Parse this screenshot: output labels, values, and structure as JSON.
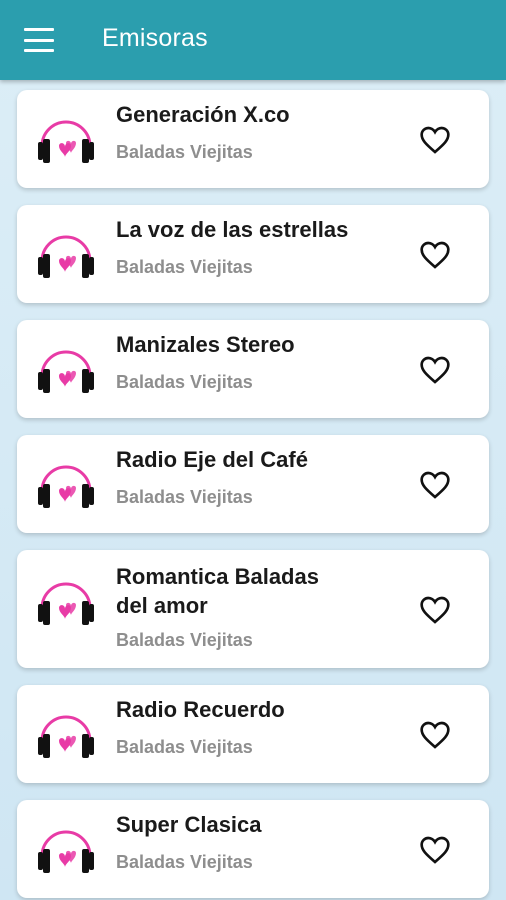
{
  "appbar": {
    "title": "Emisoras",
    "menu_icon": "hamburger-menu-icon"
  },
  "stations": [
    {
      "name": "Generación X.co",
      "genre": "Baladas Viejitas"
    },
    {
      "name": "La voz de las estrellas",
      "genre": "Baladas Viejitas"
    },
    {
      "name": "Manizales Stereo",
      "genre": "Baladas Viejitas"
    },
    {
      "name": "Radio Eje del Café",
      "genre": "Baladas Viejitas"
    },
    {
      "name": "Romantica Baladas del amor",
      "genre": "Baladas Viejitas"
    },
    {
      "name": "Radio Recuerdo",
      "genre": "Baladas Viejitas"
    },
    {
      "name": "Super Clasica",
      "genre": "Baladas Viejitas"
    }
  ],
  "colors": {
    "appbar": "#2b9eae",
    "accent": "#e83ba6"
  }
}
